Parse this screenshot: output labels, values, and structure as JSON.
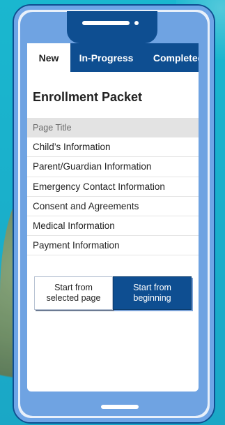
{
  "phone": {
    "tabs": [
      {
        "label": "New",
        "active": true
      },
      {
        "label": "In-Progress",
        "active": false
      },
      {
        "label": "Completed",
        "active": false
      }
    ],
    "title": "Enrollment Packet",
    "list_header": "Page Title",
    "pages": [
      "Child’s Information",
      "Parent/Guardian Information",
      "Emergency Contact Information",
      "Consent and Agreements",
      "Medical Information",
      "Payment Information"
    ],
    "buttons": {
      "secondary": "Start from selected page",
      "primary": "Start from beginning"
    }
  },
  "colors": {
    "background": "#1ab7cf",
    "phone_frame": "#0e4e91",
    "phone_inner": "#6fa3e2",
    "tab_bar": "#0e4e91",
    "screen": "#ffffff",
    "list_header_bg": "#e3e3e3",
    "button_primary": "#0e4e91"
  },
  "icons": {
    "speaker": "speaker-icon",
    "camera": "camera-icon",
    "home_indicator": "home-indicator-icon"
  }
}
